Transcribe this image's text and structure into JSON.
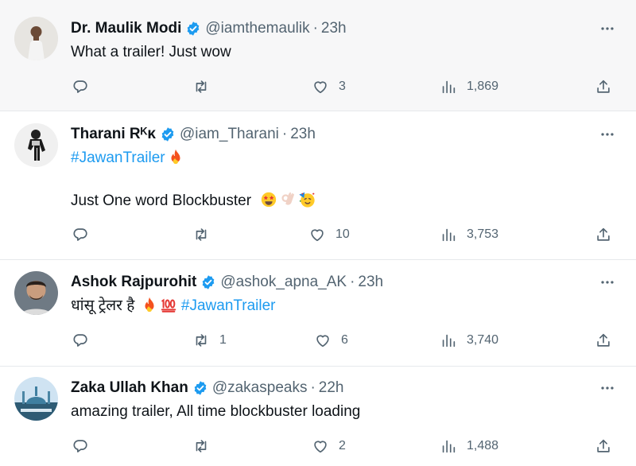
{
  "tweets": [
    {
      "name": "Dr. Maulik Modi",
      "handle": "@iamthemaulik",
      "dot": "·",
      "time": "23h",
      "lines": [
        "What a trailer! Just wow"
      ],
      "replies": "",
      "retweets": "",
      "likes": "3",
      "views": "1,869"
    },
    {
      "name": "Tharani Rᴷᴋ",
      "handle": "@iam_Tharani",
      "dot": "·",
      "time": "23h",
      "hashtag": "#JawanTrailer",
      "body": "Just One word Blockbuster",
      "emojis": [
        "fire",
        "star-struck",
        "ok-hand",
        "partying-face"
      ],
      "replies": "",
      "retweets": "",
      "likes": "10",
      "views": "3,753"
    },
    {
      "name": "Ashok Rajpurohit",
      "handle": "@ashok_apna_AK",
      "dot": "·",
      "time": "23h",
      "text_prefix": "धांसू ट्रेलर है",
      "hashtag": "#JawanTrailer",
      "emojis": [
        "fire",
        "hundred-points"
      ],
      "replies": "",
      "retweets": "1",
      "likes": "6",
      "views": "3,740"
    },
    {
      "name": "Zaka Ullah Khan",
      "handle": "@zakaspeaks",
      "dot": "·",
      "time": "22h",
      "lines": [
        "amazing trailer, All time blockbuster loading"
      ],
      "replies": "",
      "retweets": "",
      "likes": "2",
      "views": "1,488"
    }
  ],
  "icons": [
    "reply-icon",
    "retweet-icon",
    "like-icon",
    "views-icon",
    "share-icon",
    "more-icon",
    "verified-badge-icon"
  ],
  "colors": {
    "link": "#1d9bf0",
    "muted": "#536471",
    "verified": "#1d9bf0",
    "highlight_bg": "#f7f7f8"
  }
}
